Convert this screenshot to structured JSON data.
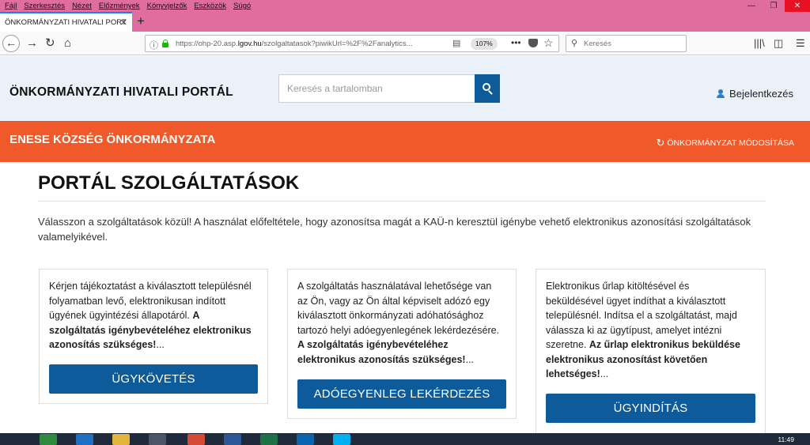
{
  "browser": {
    "menu": [
      "Fájl",
      "Szerkesztés",
      "Nézet",
      "Előzmények",
      "Könyvjelzők",
      "Eszközök",
      "Súgó"
    ],
    "window_controls": {
      "minimize": "—",
      "restore": "❐",
      "close": "✕"
    },
    "tab_title": "ÖNKORMÁNYZATI HIVATALI PORT",
    "new_tab": "+",
    "url_prefix": "https://ohp-20.asp.",
    "url_domain": "lgov.hu",
    "url_path": "/szolgaltatasok?piwikUrl=%2F%2Fanalytics...",
    "zoom": "107%",
    "search_placeholder": "Keresés"
  },
  "header": {
    "site_title": "ÖNKORMÁNYZATI HIVATALI PORTÁL",
    "search_placeholder": "Keresés a tartalomban",
    "login_label": "Bejelentkezés"
  },
  "municipality": {
    "name": "ENESE KÖZSÉG ÖNKORMÁNYZATA",
    "change_label": "ÖNKORMÁNYZAT MÓDOSÍTÁSA"
  },
  "main": {
    "title": "PORTÁL SZOLGÁLTATÁSOK",
    "intro": "Válasszon a szolgáltatások közül! A használat előfeltétele, hogy azonosítsa magát a KAÜ-n keresztül igénybe vehető elektronikus azonosítási szolgáltatások valamelyikével.",
    "cards": [
      {
        "lines": [
          "Kérjen tájékoztatást a kiválasztott településnél",
          "folyamatban levő, elektronikusan indított",
          "ügyének ügyintézési állapotáról. "
        ],
        "bold_lines": [
          "A",
          "szolgáltatás igénybevételéhez elektronikus",
          "azonosítás szükséges!"
        ],
        "ellipsis": "...",
        "button": "ÜGYKÖVETÉS"
      },
      {
        "lines": [
          "A szolgáltatás használatával lehetősége van",
          "az Ön, vagy az Ön által képviselt adózó egy",
          "kiválasztott önkormányzati adóhatósághoz",
          "tartozó helyi adóegyenlegének lekérdezésére."
        ],
        "bold_lines": [
          "A szolgáltatás igénybevételéhez",
          "elektronikus azonosítás szükséges!"
        ],
        "ellipsis": "...",
        "button": "ADÓEGYENLEG LEKÉRDEZÉS"
      },
      {
        "lines": [
          "Elektronikus űrlap kitöltésével és",
          "beküldésével ügyet indíthat a kiválasztott",
          "településnél. Indítsa el a szolgáltatást, majd",
          "válassza ki az ügytípust, amelyet intézni",
          "szeretne. "
        ],
        "bold_lines": [
          "Az űrlap elektronikus beküldése",
          "elektronikus azonosítást követően",
          "lehetséges!"
        ],
        "ellipsis": "...",
        "button": "ÜGYINDÍTÁS"
      }
    ]
  },
  "taskbar": {
    "clock": "11:49"
  },
  "colors": {
    "header_bg": "#eaf1f9",
    "brand_orange": "#f05a2b",
    "button_blue": "#0d5b9b",
    "chrome_pink": "#df6e9e"
  }
}
